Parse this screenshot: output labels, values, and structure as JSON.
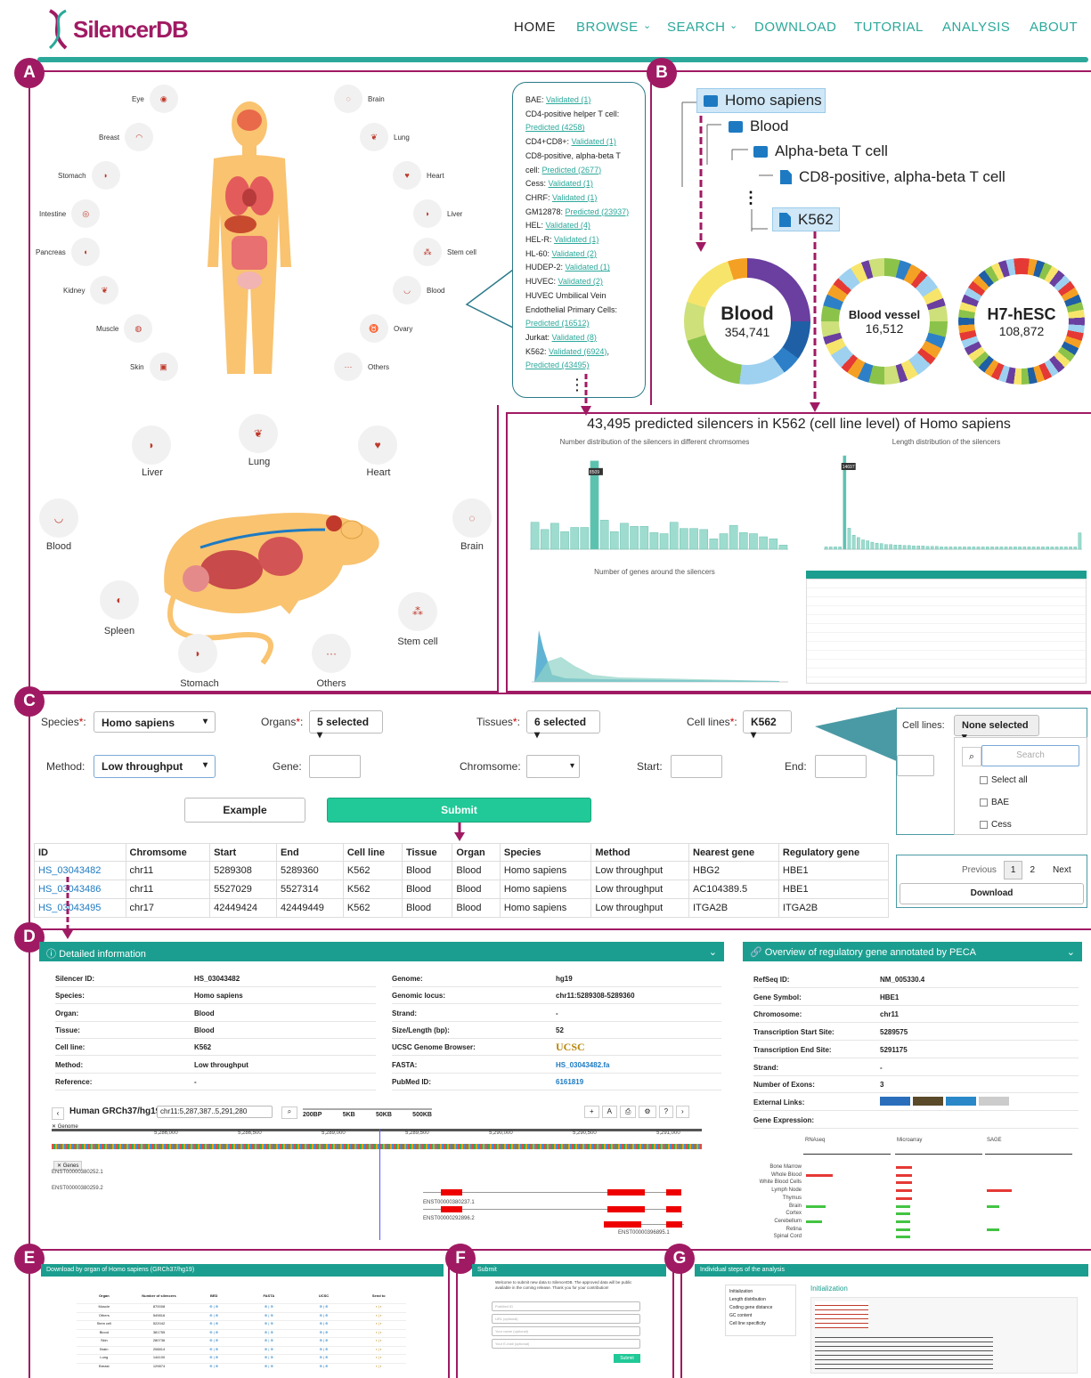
{
  "header": {
    "logo": "SilencerDB",
    "nav": [
      "HOME",
      "BROWSE",
      "SEARCH",
      "DOWNLOAD",
      "TUTORIAL",
      "ANALYSIS",
      "ABOUT"
    ],
    "accent": "#2ba89a"
  },
  "badges": [
    "A",
    "B",
    "C",
    "D",
    "E",
    "F",
    "G"
  ],
  "human_organs_left": [
    "Eye",
    "Breast",
    "Stomach",
    "Intestine",
    "Pancreas",
    "Kidney",
    "Muscle",
    "Skin"
  ],
  "human_organs_right": [
    "Brain",
    "Lung",
    "Heart",
    "Liver",
    "Stem cell",
    "Blood",
    "Ovary",
    "Others"
  ],
  "cell_list": [
    {
      "label": "BAE:",
      "links": [
        "Validated (1)"
      ]
    },
    {
      "label": "CD4-positive helper T cell:",
      "links": [
        "Predicted (4258)"
      ]
    },
    {
      "label": "CD4+CD8+:",
      "links": [
        "Validated (1)"
      ]
    },
    {
      "label": "CD8-positive, alpha-beta T cell:",
      "links": [
        "Predicted (2677)"
      ]
    },
    {
      "label": "Cess:",
      "links": [
        "Validated (1)"
      ]
    },
    {
      "label": "CHRF:",
      "links": [
        "Validated (1)"
      ]
    },
    {
      "label": "GM12878:",
      "links": [
        "Predicted (23937)"
      ]
    },
    {
      "label": "HEL:",
      "links": [
        "Validated (4)"
      ]
    },
    {
      "label": "HEL-R:",
      "links": [
        "Validated (1)"
      ]
    },
    {
      "label": "HL-60:",
      "links": [
        "Validated (2)"
      ]
    },
    {
      "label": "HUDEP-2:",
      "links": [
        "Validated (1)"
      ]
    },
    {
      "label": "HUVEC:",
      "links": [
        "Validated (2)"
      ]
    },
    {
      "label": "HUVEC Umbilical Vein Endothelial Primary Cells:",
      "links": [
        "Predicted (16512)"
      ]
    },
    {
      "label": "Jurkat:",
      "links": [
        "Validated (8)"
      ]
    },
    {
      "label": "K562:",
      "links": [
        "Validated (6924)",
        "Predicted (43495)"
      ]
    }
  ],
  "mouse_organs": [
    "Liver",
    "Lung",
    "Heart",
    "Blood",
    "Brain",
    "Spleen",
    "Stem cell",
    "Stomach",
    "Others"
  ],
  "tree": [
    "Homo sapiens",
    "Blood",
    "Alpha-beta T cell",
    "CD8-positive, alpha-beta T cell",
    "K562"
  ],
  "donuts": [
    {
      "name": "Blood",
      "value": "354,741"
    },
    {
      "name": "Blood vessel",
      "value": "16,512"
    },
    {
      "name": "H7-hESC",
      "value": "108,872"
    }
  ],
  "k562_title": "43,495 predicted silencers in K562 (cell line level) of Homo sapiens",
  "chart_titles": [
    "Number distribution of the silencers in different chromsomes",
    "Length distribution of the silencers",
    "Number of genes around the silencers"
  ],
  "chart_data": [
    {
      "type": "bar",
      "title": "Number distribution of the silencers in different chromsomes",
      "series": [
        {
          "values": [
            2600,
            1900,
            2500,
            1700,
            2100,
            2100,
            8500,
            2800,
            1700,
            2500,
            2200,
            2200,
            1600,
            1500,
            2600,
            2000,
            2000,
            1900,
            1000,
            1500,
            2300,
            1600,
            1500,
            1200,
            1000,
            400
          ]
        }
      ],
      "ylim": [
        0,
        9000
      ],
      "labels": [
        "8509"
      ]
    },
    {
      "type": "bar",
      "title": "Length distribution of the silencers",
      "series": [
        {
          "values": [
            500,
            500,
            500,
            500,
            20000,
            4500,
            3000,
            2500,
            2000,
            1800,
            1500,
            1300,
            1200,
            1000,
            1000,
            900,
            900,
            800,
            800,
            700,
            700,
            700,
            600,
            600,
            600,
            500,
            500,
            500,
            500,
            500,
            500,
            500,
            500,
            500,
            500,
            500,
            500,
            500,
            500,
            500,
            500,
            500,
            500,
            500,
            500,
            500,
            500,
            500,
            500,
            500,
            500,
            500,
            500,
            500,
            500,
            3500
          ]
        }
      ],
      "ylim": [
        0,
        20000
      ],
      "labels": [
        "14697"
      ]
    },
    {
      "type": "area",
      "title": "Number of genes around the silencers",
      "ylim": [
        0,
        40000
      ]
    }
  ],
  "form": {
    "species_label": "Species",
    "species_value": "Homo sapiens",
    "organs_label": "Organs",
    "organs_value": "5 selected",
    "tissues_label": "Tissues",
    "tissues_value": "6 selected",
    "celllines_label": "Cell lines",
    "celllines_value": "K562",
    "method_label": "Method:",
    "method_value": "Low throughput",
    "gene_label": "Gene:",
    "chromosome_label": "Chromsome:",
    "start_label": "Start:",
    "end_label": "End:",
    "example_btn": "Example",
    "submit_btn": "Submit",
    "required_mark": "*",
    "colon": ":"
  },
  "dropdown": {
    "label": "Cell lines:",
    "button": "None selected",
    "search_placeholder": "Search",
    "options": [
      "Select all",
      "BAE",
      "Cess"
    ]
  },
  "results": {
    "headers": [
      "ID",
      "Chromsome",
      "Start",
      "End",
      "Cell line",
      "Tissue",
      "Organ",
      "Species",
      "Method",
      "Nearest gene",
      "Regulatory gene"
    ],
    "rows": [
      [
        "HS_03043482",
        "chr11",
        "5289308",
        "5289360",
        "K562",
        "Blood",
        "Blood",
        "Homo sapiens",
        "Low throughput",
        "HBG2",
        "HBE1"
      ],
      [
        "HS_03043486",
        "chr11",
        "5527029",
        "5527314",
        "K562",
        "Blood",
        "Blood",
        "Homo sapiens",
        "Low throughput",
        "AC104389.5",
        "HBE1"
      ],
      [
        "HS_03043495",
        "chr17",
        "42449424",
        "42449449",
        "K562",
        "Blood",
        "Blood",
        "Homo sapiens",
        "Low throughput",
        "ITGA2B",
        "ITGA2B"
      ]
    ],
    "pager": [
      "Previous",
      "1",
      "2",
      "Next"
    ],
    "download": "Download"
  },
  "detail": {
    "title": "Detailed information",
    "left": [
      [
        "Silencer ID:",
        "HS_03043482"
      ],
      [
        "Species:",
        "Homo sapiens"
      ],
      [
        "Organ:",
        "Blood"
      ],
      [
        "Tissue:",
        "Blood"
      ],
      [
        "Cell line:",
        "K562"
      ],
      [
        "Method:",
        "Low throughput"
      ],
      [
        "Reference:",
        "-"
      ]
    ],
    "right": [
      [
        "Genome:",
        "hg19"
      ],
      [
        "Genomic locus:",
        "chr11:5289308-5289360"
      ],
      [
        "Strand:",
        "-"
      ],
      [
        "Size/Length (bp):",
        "52"
      ],
      [
        "UCSC Genome Browser:",
        "UCSC"
      ],
      [
        "FASTA:",
        "HS_03043482.fa"
      ],
      [
        "PubMed ID:",
        "6161819"
      ]
    ],
    "browser_title": "Human GRCh37/hg19",
    "browser_locus": "chr11:5,287,387..5,291,280",
    "zoom": [
      "200BP",
      "5KB",
      "50KB",
      "500KB"
    ],
    "ruler": [
      "5,286,000",
      "5,286,500",
      "5,289,000",
      "5,289,500",
      "5,290,000",
      "5,290,500",
      "5,291,000"
    ],
    "tracks": [
      "Genome",
      "Genes"
    ],
    "transcripts": [
      "ENST00000380252.1",
      "ENST00000380259.2",
      "ENST00000380237.1",
      "ENST00000292896.2",
      "ENST00000396895.1"
    ]
  },
  "peca": {
    "title": "Overview of regulatory gene annotated by PECA",
    "rows": [
      [
        "RefSeq ID:",
        "NM_005330.4"
      ],
      [
        "Gene Symbol:",
        "HBE1"
      ],
      [
        "Chromosome:",
        "chr11"
      ],
      [
        "Transcription Start Site:",
        "5289575"
      ],
      [
        "Transcription End Site:",
        "5291175"
      ],
      [
        "Strand:",
        "-"
      ],
      [
        "Number of Exons:",
        "3"
      ],
      [
        "External Links:",
        ""
      ],
      [
        "Gene Expression:",
        ""
      ]
    ],
    "expr_cols": [
      "RNAseq",
      "Microarray",
      "SAGE"
    ],
    "tissues": [
      "Bone Marrow",
      "Whole Blood",
      "White Blood Cells",
      "Lymph Node",
      "Thymus",
      "Brain",
      "Cortex",
      "Cerebellum",
      "Retina",
      "Spinal Cord"
    ]
  },
  "panel_e": {
    "title": "Download by organ of Homo sapiens (GRCh37/hg19)",
    "organs": [
      "Muscle",
      "Others",
      "Stem cell",
      "Blood",
      "Skin",
      "Brain",
      "Lung",
      "Breast"
    ],
    "counts": [
      "870008",
      "549816",
      "522042",
      "381755",
      "280736",
      "208814",
      "144100",
      "129874"
    ],
    "headers": [
      "Organ",
      "Number of silencers",
      "BED",
      "FASTA",
      "UCSC",
      "Send to"
    ]
  },
  "panel_f": {
    "title": "Submit",
    "text": "Welcome to submit new data to SilencerDB. The approved data will be public available in the coming release. Thank you for your contribution!",
    "fields": [
      "PubMed ID",
      "URL (optional)",
      "Your name (optional)",
      "Your E-mail (optional)"
    ],
    "button": "Submit"
  },
  "panel_g": {
    "title": "Individual steps of the analysis",
    "steps": [
      "Initialization",
      "Length distribution",
      "Coding gene distance",
      "GC content",
      "Cell line specificity"
    ],
    "heading": "Initialization"
  }
}
